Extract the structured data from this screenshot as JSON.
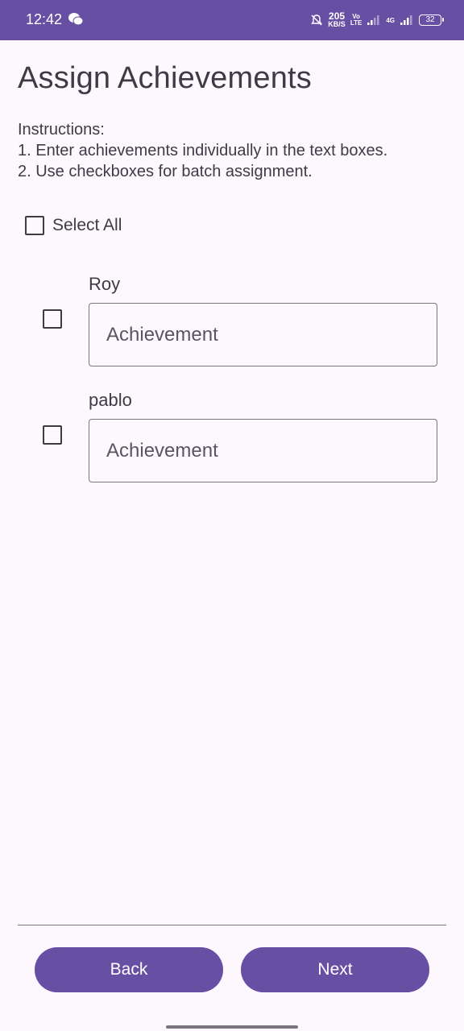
{
  "status_bar": {
    "time": "12:42",
    "speed_value": "205",
    "speed_unit": "KB/S",
    "volte_top": "Vo",
    "volte_bottom": "LTE",
    "network": "4G",
    "battery": "32",
    "icons": [
      "wechat-icon",
      "bell-off-icon",
      "signal-icon",
      "signal-icon"
    ]
  },
  "page": {
    "title": "Assign Achievements",
    "instructions": [
      "Instructions:",
      "1. Enter achievements individually in the text boxes.",
      "2. Use checkboxes for batch assignment."
    ],
    "select_all_label": "Select All"
  },
  "users": [
    {
      "name": "Roy",
      "placeholder": "Achievement",
      "checked": false
    },
    {
      "name": "pablo",
      "placeholder": "Achievement",
      "checked": false
    }
  ],
  "footer": {
    "back_label": "Back",
    "next_label": "Next"
  },
  "colors": {
    "primary": "#6750a4",
    "background": "#fdf8fd",
    "text": "#3f3b44"
  }
}
